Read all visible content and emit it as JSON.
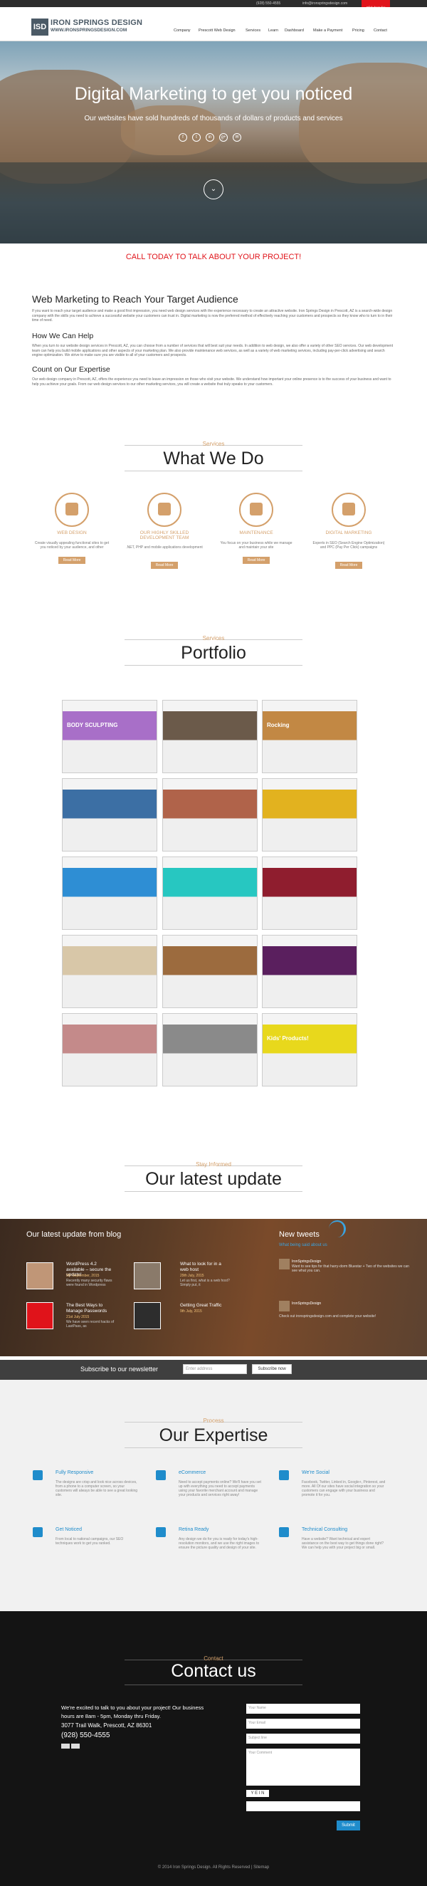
{
  "topbar": {
    "phone": "(928) 550-4555",
    "email": "info@ironspringsdesign.com",
    "cta_line1": "Click here for",
    "cta_line2": "Free Evaluation"
  },
  "header": {
    "logo_mark": "ISD",
    "logo_name": "IRON SPRINGS DESIGN",
    "logo_url": "WWW.IRONSPRINGSDESIGN.COM",
    "nav": [
      "Company",
      "Prescott Web Design",
      "Services",
      "Learn",
      "Dashboard",
      "Make a Payment",
      "Pricing",
      "Contact"
    ]
  },
  "hero": {
    "title": "Digital Marketing to get you noticed",
    "subtitle": "Our websites have sold hundreds of thousands of dollars of products and services",
    "social": [
      "f",
      "t",
      "in",
      "g+",
      "✉"
    ],
    "down_icon": "⌄"
  },
  "cta": "CALL TODAY TO TALK ABOUT YOUR PROJECT!",
  "about": {
    "heading": "Web Marketing to Reach Your Target Audience",
    "p1": "If you want to reach your target audience and make a good first impression, you need web design services with the experience necessary to create an attractive website. Iron Springs Design in Prescott, AZ is a search-wide design company with the skills you need to achieve a successful website your customers can trust in. Digital marketing is now the preferred method of effectively reaching your customers and prospects so they know who to turn to in their time of need.",
    "help_heading": "How We Can Help",
    "p2": "When you turn to our website design services in Prescott, AZ, you can choose from a number of services that will best suit your needs. In addition to web design, we also offer a variety of other SEO services. Our web development team can help you build mobile applications and other aspects of your marketing plan. We also provide maintenance web services, as well as a variety of web marketing services, including pay-per-click advertising and search engine optimization. We strive to make sure you are visible to all of your customers and prospects.",
    "count_heading": "Count on Our Expertise",
    "p3": "Our web design company in Prescott, AZ, offers the experience you need to leave an impression on those who visit your website. We understand how important your online presence is to the success of your business and want to help you achieve your goals. From our web design services to our other marketing services, you will create a website that truly speaks to your customers."
  },
  "what_we_do": {
    "kicker": "Services",
    "title": "What We Do",
    "items": [
      {
        "icon": "monitor-icon",
        "title": "WEB DESIGN",
        "desc": "Create visually appealing functional sites to get you noticed by your audience, and other",
        "button": "Read More"
      },
      {
        "icon": "code-icon",
        "title": "OUR HIGHLY SKILLED DEVELOPMENT TEAM",
        "desc": ".NET, PHP and mobile applications development",
        "button": "Read More"
      },
      {
        "icon": "gear-icon",
        "title": "MAINTENANCE",
        "desc": "You focus on your business while we manage and maintain your site",
        "button": "Read More"
      },
      {
        "icon": "chart-icon",
        "title": "DIGITAL MARKETING",
        "desc": "Experts in SEO (Search Engine Optimization) and PPC (Pay Per Click) campaigns",
        "button": "Read More"
      }
    ]
  },
  "portfolio": {
    "kicker": "Services",
    "title": "Portfolio",
    "items": [
      {
        "heading": "BODY SCULPTING",
        "color": "#a86fc8"
      },
      {
        "heading": "",
        "color": "#6b5a4a"
      },
      {
        "heading": "Rocking",
        "color": "#c28844"
      },
      {
        "heading": "",
        "color": "#3c6fa4"
      },
      {
        "heading": "",
        "color": "#b0634a"
      },
      {
        "heading": "",
        "color": "#e2b21f"
      },
      {
        "heading": "",
        "color": "#2e8ed4"
      },
      {
        "heading": "",
        "color": "#27c7c1"
      },
      {
        "heading": "",
        "color": "#8f1d2e"
      },
      {
        "heading": "",
        "color": "#d8c7a8"
      },
      {
        "heading": "",
        "color": "#9c6b3e"
      },
      {
        "heading": "",
        "color": "#5a1f5e"
      },
      {
        "heading": "",
        "color": "#c48a8a"
      },
      {
        "heading": "",
        "color": "#8a8a8a"
      },
      {
        "heading": "Kids' Products!",
        "color": "#e8d81c"
      }
    ]
  },
  "latest": {
    "kicker": "Stay Informed",
    "title": "Our latest update"
  },
  "blog": {
    "heading": "Our latest update from blog",
    "posts": [
      {
        "title": "WordPress 4.2 available – secure the update!",
        "date": "9th September, 2015",
        "excerpt": "Recently many security flaws were found in Wordpress"
      },
      {
        "title": "What to look for in a web host",
        "date": "29th July, 2015",
        "excerpt": "Let us first, what is a web host? Simply put, it"
      },
      {
        "title": "The Best Ways to Manage Passwords",
        "date": "21st July 2015",
        "excerpt": "We have seen recent hacks of LastPass, as"
      },
      {
        "title": "Getting Great Traffic",
        "date": "9th July, 2015",
        "excerpt": ""
      }
    ]
  },
  "tweets": {
    "heading": "New tweets",
    "handle": "What being said about us",
    "items": [
      {
        "user": "IronSpringsDesign",
        "text": "Want to see tips for that harry-dorm Bluestar + Two of the websites we can see what you can."
      },
      {
        "user": "IronSpringsDesign",
        "text": "Check out ironspringsdesign.com and complete your website!"
      }
    ]
  },
  "newsletter": {
    "label": "Subscribe to our newsletter",
    "placeholder": "Enter address",
    "button": "Subscribe now"
  },
  "expertise": {
    "kicker": "Process",
    "title": "Our Expertise",
    "items": [
      {
        "icon": "monitor-icon",
        "title": "Fully Responsive",
        "desc": "The designs are crisp and look nice across devices, from a phone to a computer screen, so your customers will always be able to see a great looking site."
      },
      {
        "icon": "cart-icon",
        "title": "eCommerce",
        "desc": "Need to accept payments online? We'll have you set up with everything you need to accept payments using your favorite merchant account and manage your products and services right away!"
      },
      {
        "icon": "share-icon",
        "title": "We're Social",
        "desc": "Facebook, Twitter, Linked in, Google+, Pinterest, and more. All Of our sites have social integration so your customers can engage with your business and promote it for you."
      },
      {
        "icon": "search-icon",
        "title": "Get Noticed",
        "desc": "From local to national campaigns, our SEO techniques work to get you ranked."
      },
      {
        "icon": "screen-icon",
        "title": "Retina Ready",
        "desc": "Any design we do for you is ready for today's high-resolution monitors, and we use the right images to ensure the picture quality and design of your site."
      },
      {
        "icon": "star-icon",
        "title": "Technical Consulting",
        "desc": "Have a website? Want technical and expert assistance on the best way to get things done right? We can help you with your project big or small."
      }
    ]
  },
  "contact": {
    "kicker": "Contact",
    "title": "Contact us",
    "intro1": "We're excited to talk to you about your project! Our business",
    "intro2": "hours are 8am - 5pm, Monday thru Friday.",
    "address": "3077 Trail Walk, Prescott, AZ 86301",
    "phone": "(928) 550-4555",
    "fields": [
      "Your Name",
      "Your Email",
      "Subject line",
      "Your Comment"
    ],
    "captcha": "Y E I N",
    "submit": "Submit"
  },
  "footer": "© 2014 Iron Springs Design. All Rights Reserved | Sitemap"
}
